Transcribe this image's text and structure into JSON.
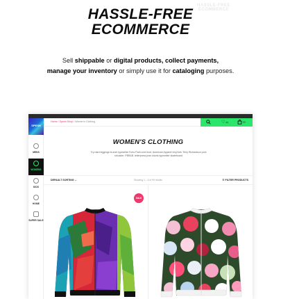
{
  "hero": {
    "title_line1": "HASSLE-FREE",
    "title_line2": "ECOMMERCE",
    "watermark_line1": "HASSLE-FREE",
    "watermark_line2": "ECOMMERCE",
    "desc": {
      "p1": "Sell ",
      "b1": "shippable",
      "p2": " or ",
      "b2": "digital products, collect payments,",
      "b3": "manage your inventory",
      "p3": " or simply use it for ",
      "b4": "cataloging",
      "p4": " purposes."
    }
  },
  "app": {
    "logo_text": "SPESH",
    "sidebar": [
      {
        "label": "MENS",
        "icon": "person-icon"
      },
      {
        "label": "WOMENS",
        "icon": "person-icon",
        "active": true
      },
      {
        "label": "KIDS",
        "icon": "child-icon"
      },
      {
        "label": "HOME",
        "icon": "home-icon"
      },
      {
        "label": "SUPER SALE",
        "icon": "tag-icon"
      }
    ],
    "breadcrumb": {
      "home": "Home",
      "shop": "Spesh Shop",
      "current": "Women's Clothing"
    },
    "toolbar": {
      "wishlist_count": "(0)",
      "cart_count": "(0)"
    },
    "page_title": "WOMEN'S CLOTHING",
    "page_desc": "Try-hard leggings brunch typewriter Echo Park cred food. American Apparel vinyl tofu Terry Richardson pork shoulder. PBR&B. letterpress jean shorts typewriter skateboard",
    "filterbar": {
      "sort": "DEFAULT SORTING",
      "showing": "Showing 1 – 6 of 99 results",
      "filter": "FILTER PRODUCTS"
    },
    "sale_badge": "SALE"
  },
  "colors": {
    "accent_green": "#2ce66b",
    "sale_pink": "#ec3a6e",
    "crumb_pink": "#e33a7a"
  }
}
